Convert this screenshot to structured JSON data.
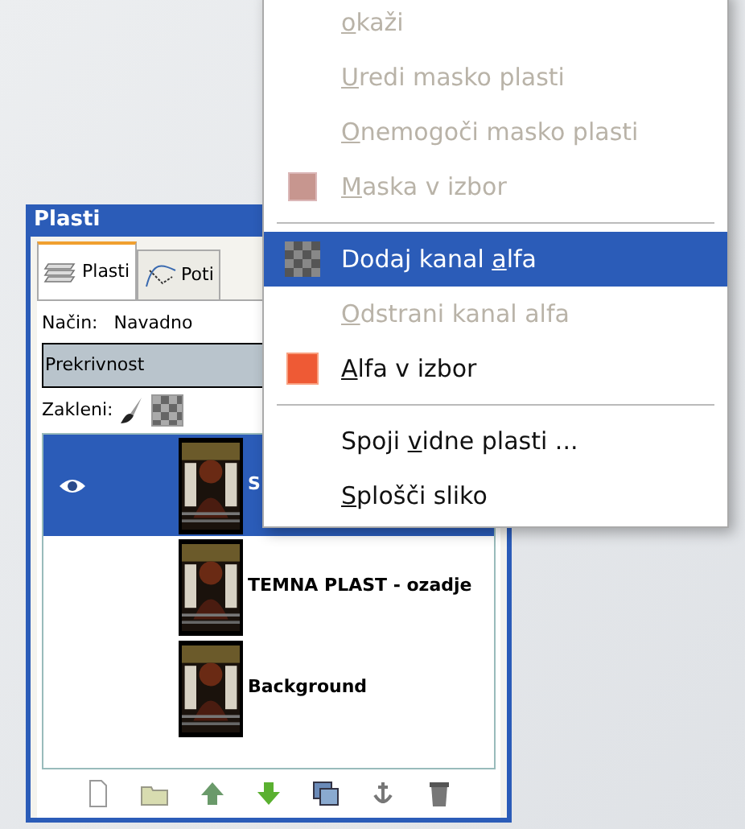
{
  "layers_window": {
    "title": "Plasti",
    "tabs": [
      {
        "label": "Plasti",
        "selected": true
      },
      {
        "label": "Poti",
        "selected": false
      }
    ],
    "mode": {
      "label": "Način:",
      "value": "Navadno"
    },
    "opacity": {
      "label": "Prekrivnost"
    },
    "lock": {
      "label": "Zakleni:"
    },
    "layers": [
      {
        "name": "S",
        "visible": true,
        "selected": true
      },
      {
        "name": "TEMNA PLAST - ozadje",
        "visible": false,
        "selected": false
      },
      {
        "name": "Background",
        "visible": false,
        "selected": false
      }
    ]
  },
  "context_menu": {
    "items": [
      {
        "kind": "plain",
        "key": "o",
        "post": "kaži",
        "disabled": true,
        "selected": false
      },
      {
        "kind": "plain",
        "key": "U",
        "post": "redi masko plasti",
        "disabled": true,
        "selected": false
      },
      {
        "kind": "plain",
        "key": "O",
        "post": "nemogoči masko plasti",
        "disabled": true,
        "selected": false
      },
      {
        "kind": "mask",
        "key": "M",
        "post": "aska v izbor",
        "disabled": true,
        "selected": false
      },
      {
        "kind": "separator"
      },
      {
        "kind": "checker",
        "pre": "Dodaj kanal ",
        "key": "a",
        "post": "lfa",
        "disabled": false,
        "selected": true
      },
      {
        "kind": "plain",
        "key": "O",
        "post": "dstrani kanal alfa",
        "disabled": true,
        "selected": false
      },
      {
        "kind": "alpha",
        "key": "A",
        "post": "lfa v izbor",
        "disabled": false,
        "selected": false
      },
      {
        "kind": "separator"
      },
      {
        "kind": "plain",
        "pre": "Spoji ",
        "key": "v",
        "post": "idne plasti ...",
        "disabled": false,
        "selected": false
      },
      {
        "kind": "plain",
        "key": "S",
        "post": "plošči sliko",
        "disabled": false,
        "selected": false
      }
    ]
  }
}
